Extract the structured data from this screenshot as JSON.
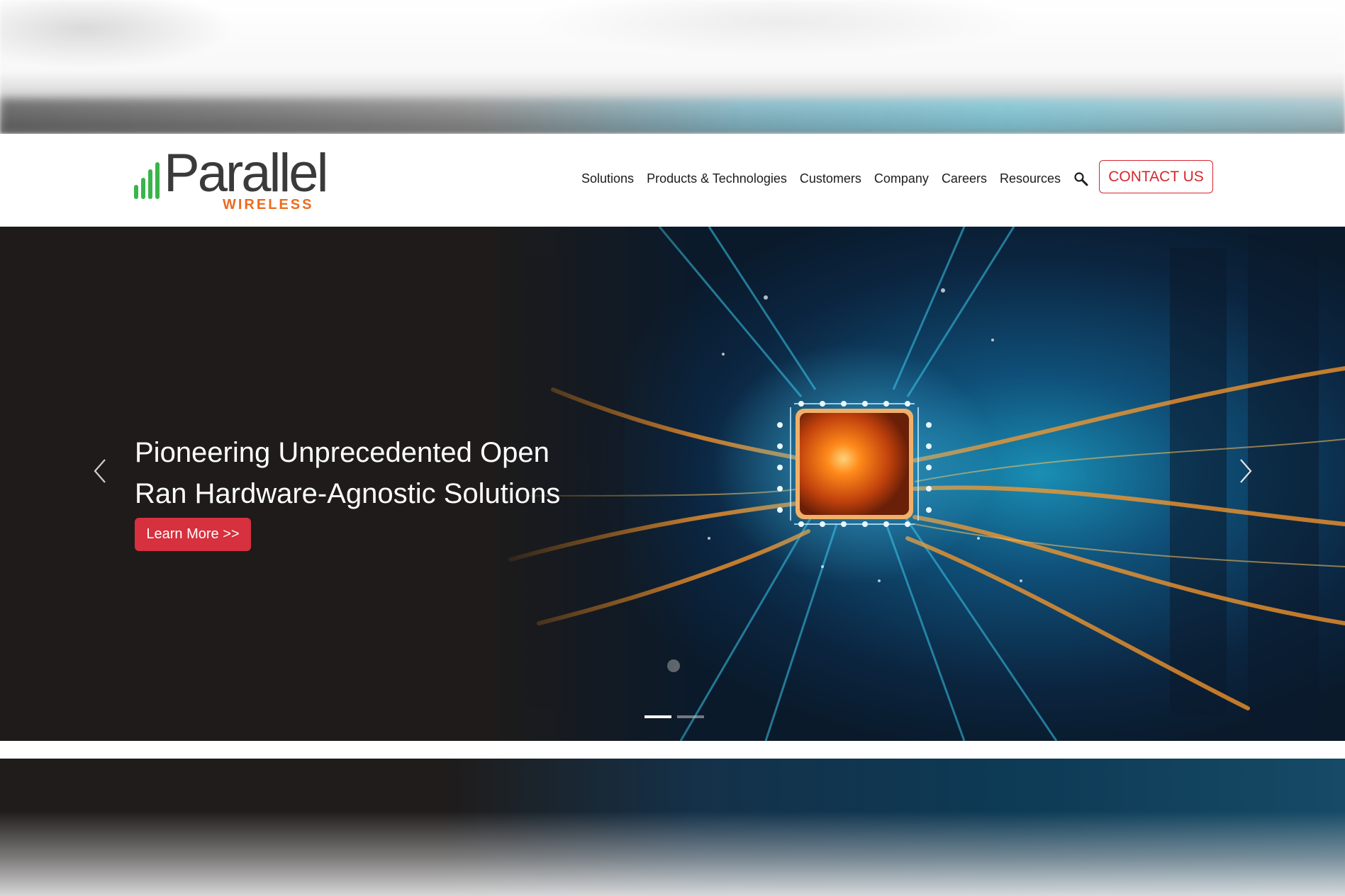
{
  "brand": {
    "name": "Parallel",
    "subtitle": "WIRELESS",
    "colors": {
      "bars": "#3ab54a",
      "wordmark": "#3a3a3a",
      "subtitle": "#ee6a1e"
    }
  },
  "nav": {
    "items": [
      {
        "label": "Solutions"
      },
      {
        "label": "Products & Technologies"
      },
      {
        "label": "Customers"
      },
      {
        "label": "Company"
      },
      {
        "label": "Careers"
      },
      {
        "label": "Resources"
      }
    ],
    "search_icon": "search-icon",
    "contact_label": "CONTACT US",
    "accent": "#d7262f"
  },
  "hero": {
    "title_line1": "Pioneering Unprecedented Open",
    "title_line2": "Ran Hardware-Agnostic Solutions",
    "cta_label": "Learn More >>",
    "cta_color": "#d7303e",
    "prev_icon": "chevron-left-icon",
    "next_icon": "chevron-right-icon",
    "slides_total": 2,
    "active_slide": 1
  }
}
